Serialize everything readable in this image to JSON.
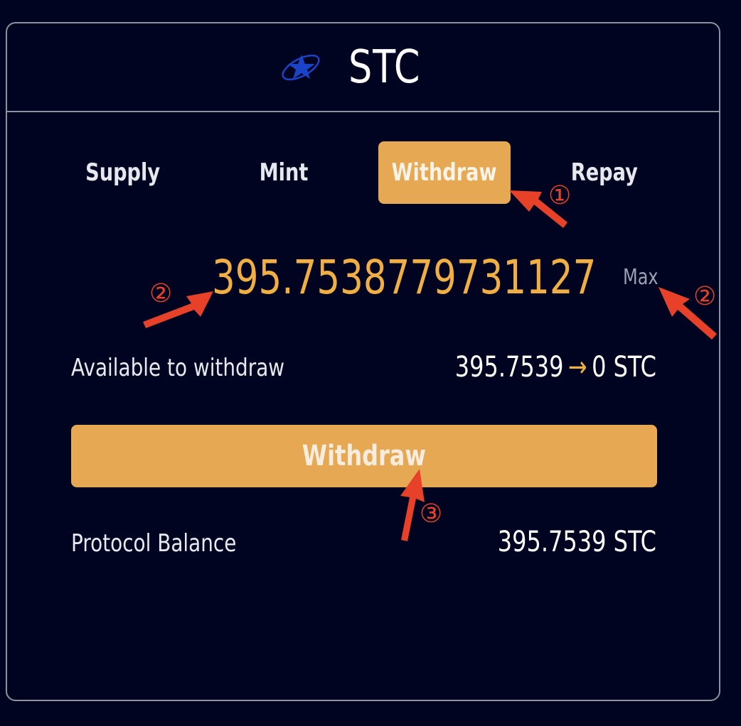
{
  "header": {
    "token_symbol": "STC",
    "token_icon": "stc-logo-icon",
    "icon_color": "#1a43c8"
  },
  "tabs": [
    {
      "label": "Supply",
      "active": false
    },
    {
      "label": "Mint",
      "active": false
    },
    {
      "label": "Withdraw",
      "active": true
    },
    {
      "label": "Repay",
      "active": false
    }
  ],
  "amount_input": {
    "value": "395.7538779731127",
    "max_label": "Max"
  },
  "available": {
    "label": "Available to withdraw",
    "from": "395.7539",
    "arrow": "→",
    "to": "0 STC"
  },
  "action_button": {
    "label": "Withdraw"
  },
  "protocol_balance": {
    "label": "Protocol Balance",
    "value": "395.7539 STC"
  },
  "annotations": {
    "marker_1": "①",
    "marker_2a": "②",
    "marker_2b": "②",
    "marker_3": "③",
    "color": "#e8412a"
  },
  "colors": {
    "background": "#000420",
    "accent": "#e6a853",
    "amount_text": "#f0ae43",
    "border": "#8f919f"
  }
}
